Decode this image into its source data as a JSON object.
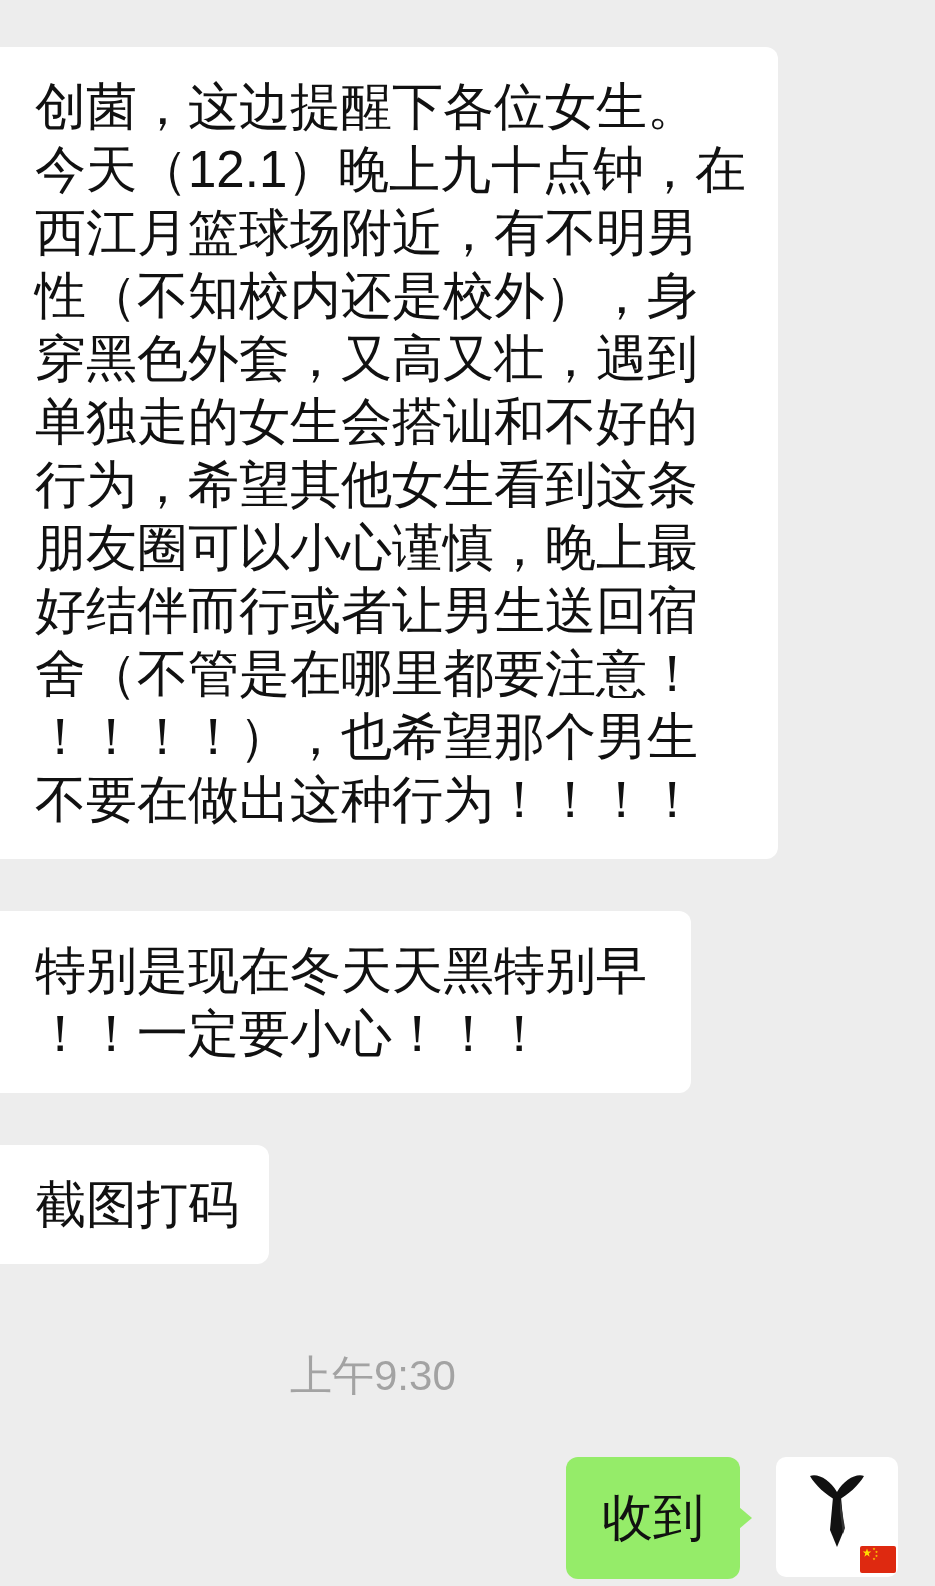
{
  "messages": [
    {
      "kind": "received",
      "text": "创菌，这边提醒下各位女生。今天（12.1）晚上九十点钟，在西江月篮球场附近，有不明男性（不知校内还是校外），身穿黑色外套，又高又壮，遇到单独走的女生会搭讪和不好的行为，希望其他女生看到这条朋友圈可以小心谨慎，晚上最好结伴而行或者让男生送回宿舍（不管是在哪里都要注意！！！！！），也希望那个男生不要在做出这种行为！！！！"
    },
    {
      "kind": "received",
      "text": "特别是现在冬天天黑特别早！！一定要小心！！！"
    },
    {
      "kind": "received",
      "text": "截图打码"
    },
    {
      "kind": "time",
      "text": "上午9:30"
    },
    {
      "kind": "sent",
      "text": "收到"
    }
  ]
}
